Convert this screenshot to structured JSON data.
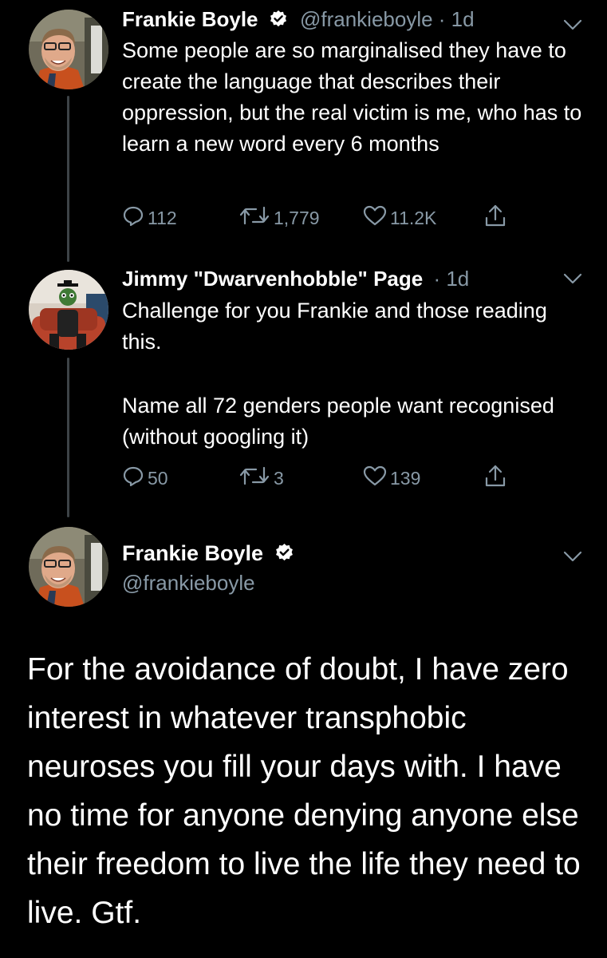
{
  "tweet1": {
    "name": "Frankie Boyle",
    "handle_time": "@frankieboyle · 1d",
    "text": "Some people are so marginalised they have to create the language that describes their oppression, but the real victim is me, who has to learn a new word every 6 months",
    "replies": "112",
    "retweets": "1,779",
    "likes": "11.2K"
  },
  "tweet2": {
    "name": "Jimmy \"Dwarvenhobble\" Page",
    "time": "· 1d",
    "text_p1": "Challenge for you Frankie and those reading this.",
    "text_p2": "Name all 72 genders people want recognised (without googling it)",
    "replies": "50",
    "retweets": "3",
    "likes": "139"
  },
  "tweet3": {
    "name": "Frankie Boyle",
    "handle": "@frankieboyle",
    "text": "For the avoidance of doubt, I have zero interest in whatever transphobic neuroses you fill your days with. I have no time for anyone denying anyone else their freedom to live the life they need to live. Gtf."
  },
  "colors": {
    "background": "#000000",
    "text": "#ffffff",
    "secondary_text": "#8899a6",
    "thread_line": "#3d4347",
    "verified_badge": "#ffffff"
  },
  "icons": [
    "verified-icon",
    "chevron-down-icon",
    "reply-icon",
    "retweet-icon",
    "like-icon",
    "share-icon"
  ]
}
